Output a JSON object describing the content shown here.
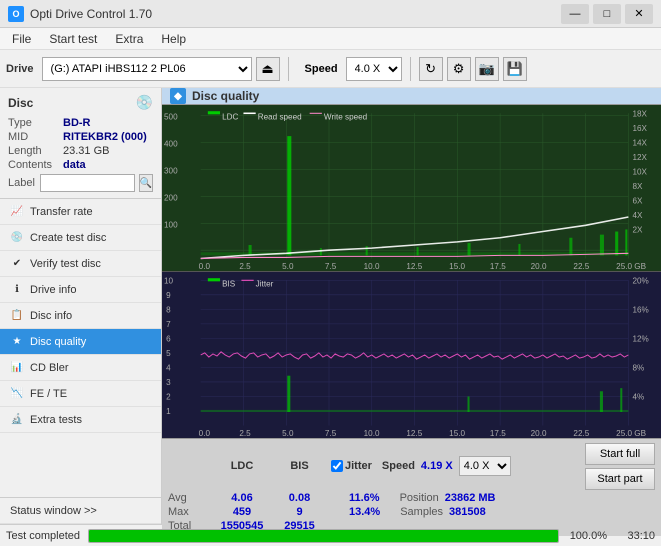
{
  "titleBar": {
    "title": "Opti Drive Control 1.70",
    "controls": [
      "—",
      "□",
      "×"
    ]
  },
  "menuBar": {
    "items": [
      "File",
      "Start test",
      "Extra",
      "Help"
    ]
  },
  "toolbar": {
    "driveLabel": "Drive",
    "driveValue": "(G:)  ATAPI iHBS112  2 PL06",
    "speedLabel": "Speed",
    "speedValue": "4.0 X"
  },
  "disc": {
    "title": "Disc",
    "type": {
      "key": "Type",
      "value": "BD-R"
    },
    "mid": {
      "key": "MID",
      "value": "RITEKBR2 (000)"
    },
    "length": {
      "key": "Length",
      "value": "23.31 GB"
    },
    "contents": {
      "key": "Contents",
      "value": "data"
    },
    "label": {
      "key": "Label",
      "value": ""
    }
  },
  "nav": {
    "items": [
      {
        "id": "transfer-rate",
        "label": "Transfer rate",
        "icon": "📈"
      },
      {
        "id": "create-test-disc",
        "label": "Create test disc",
        "icon": "💿"
      },
      {
        "id": "verify-test-disc",
        "label": "Verify test disc",
        "icon": "✔"
      },
      {
        "id": "drive-info",
        "label": "Drive info",
        "icon": "ℹ"
      },
      {
        "id": "disc-info",
        "label": "Disc info",
        "icon": "📋"
      },
      {
        "id": "disc-quality",
        "label": "Disc quality",
        "icon": "★",
        "active": true
      },
      {
        "id": "cd-bler",
        "label": "CD Bler",
        "icon": "📊"
      },
      {
        "id": "fe-te",
        "label": "FE / TE",
        "icon": "📉"
      },
      {
        "id": "extra-tests",
        "label": "Extra tests",
        "icon": "🔬"
      }
    ]
  },
  "statusWindow": {
    "label": "Status window >>"
  },
  "discQuality": {
    "title": "Disc quality",
    "legend": {
      "ldc": "LDC",
      "readSpeed": "Read speed",
      "writeSpeed": "Write speed",
      "bis": "BIS",
      "jitter": "Jitter"
    }
  },
  "stats": {
    "columns": [
      "",
      "LDC",
      "BIS",
      "",
      "Jitter",
      "Speed",
      "4.19 X",
      "4.0 X"
    ],
    "rows": [
      {
        "label": "Avg",
        "ldc": "4.06",
        "bis": "0.08",
        "jitter": "11.6%"
      },
      {
        "label": "Max",
        "ldc": "459",
        "bis": "9",
        "jitter": "13.4%"
      },
      {
        "label": "Total",
        "ldc": "1550545",
        "bis": "29515",
        "jitter": ""
      }
    ],
    "position": {
      "label": "Position",
      "value": "23862 MB"
    },
    "samples": {
      "label": "Samples",
      "value": "381508"
    },
    "speedLabel": "Speed",
    "speedValue": "4.19 X",
    "speedDropdown": "4.0 X",
    "startFull": "Start full",
    "startPart": "Start part"
  },
  "statusBar": {
    "text": "Test completed",
    "progress": 100,
    "progressText": "100.0%",
    "time": "33:10"
  },
  "chart": {
    "topYMax": 500,
    "topYLabels": [
      "500",
      "400",
      "300",
      "200",
      "100"
    ],
    "topYRightLabels": [
      "18X",
      "16X",
      "14X",
      "12X",
      "10X",
      "8X",
      "6X",
      "4X",
      "2X"
    ],
    "bottomYMax": 10,
    "bottomYLabels": [
      "10",
      "9",
      "8",
      "7",
      "6",
      "5",
      "4",
      "3",
      "2",
      "1"
    ],
    "bottomYRightLabels": [
      "20%",
      "16%",
      "12%",
      "8%",
      "4%"
    ],
    "xLabels": [
      "0.0",
      "2.5",
      "5.0",
      "7.5",
      "10.0",
      "12.5",
      "15.0",
      "17.5",
      "20.0",
      "22.5",
      "25.0 GB"
    ]
  }
}
